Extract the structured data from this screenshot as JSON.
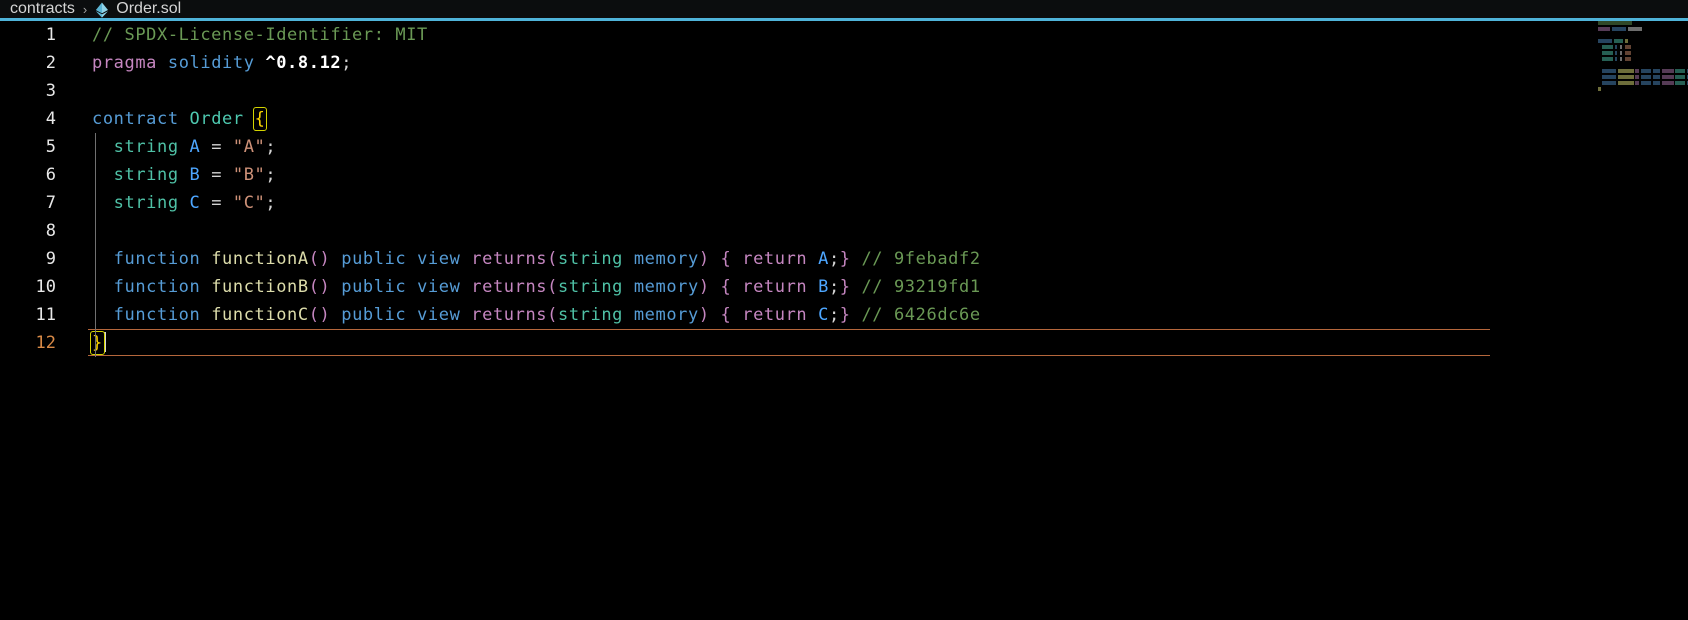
{
  "breadcrumb": {
    "folder": "contracts",
    "separator": "›",
    "file": "Order.sol",
    "file_icon": "ethereum-icon",
    "accent_color": "#4fb3d9"
  },
  "editor": {
    "language": "solidity",
    "active_line": 12,
    "cursor_line": 12,
    "cursor_column": 2,
    "background": "#000000",
    "line_count": 12,
    "lines": [
      {
        "number": "1",
        "text": "// SPDX-License-Identifier: MIT",
        "tokens": [
          {
            "t": "// SPDX-License-Identifier: MIT",
            "c": "t-comment"
          }
        ]
      },
      {
        "number": "2",
        "text": "pragma solidity ^0.8.12;",
        "tokens": [
          {
            "t": "pragma",
            "c": "t-keyword"
          },
          {
            "t": " ",
            "c": "t-plain"
          },
          {
            "t": "solidity",
            "c": "t-blue"
          },
          {
            "t": " ",
            "c": "t-plain"
          },
          {
            "t": "^0.8.12",
            "c": "t-num"
          },
          {
            "t": ";",
            "c": "t-plain"
          }
        ]
      },
      {
        "number": "3",
        "text": "",
        "tokens": []
      },
      {
        "number": "4",
        "text": "contract Order {",
        "tokens": [
          {
            "t": "contract",
            "c": "t-blue"
          },
          {
            "t": " ",
            "c": "t-plain"
          },
          {
            "t": "Order",
            "c": "t-class"
          },
          {
            "t": " ",
            "c": "t-plain"
          },
          {
            "t": "{",
            "c": "bracket-match"
          }
        ]
      },
      {
        "number": "5",
        "text": "  string A = \"A\";",
        "tokens": [
          {
            "t": "  ",
            "c": "t-plain"
          },
          {
            "t": "string",
            "c": "t-type"
          },
          {
            "t": " ",
            "c": "t-plain"
          },
          {
            "t": "A",
            "c": "t-var"
          },
          {
            "t": " = ",
            "c": "t-plain"
          },
          {
            "t": "\"A\"",
            "c": "t-string"
          },
          {
            "t": ";",
            "c": "t-plain"
          }
        ]
      },
      {
        "number": "6",
        "text": "  string B = \"B\";",
        "tokens": [
          {
            "t": "  ",
            "c": "t-plain"
          },
          {
            "t": "string",
            "c": "t-type"
          },
          {
            "t": " ",
            "c": "t-plain"
          },
          {
            "t": "B",
            "c": "t-var"
          },
          {
            "t": " = ",
            "c": "t-plain"
          },
          {
            "t": "\"B\"",
            "c": "t-string"
          },
          {
            "t": ";",
            "c": "t-plain"
          }
        ]
      },
      {
        "number": "7",
        "text": "  string C = \"C\";",
        "tokens": [
          {
            "t": "  ",
            "c": "t-plain"
          },
          {
            "t": "string",
            "c": "t-type"
          },
          {
            "t": " ",
            "c": "t-plain"
          },
          {
            "t": "C",
            "c": "t-var"
          },
          {
            "t": " = ",
            "c": "t-plain"
          },
          {
            "t": "\"C\"",
            "c": "t-string"
          },
          {
            "t": ";",
            "c": "t-plain"
          }
        ]
      },
      {
        "number": "8",
        "text": "",
        "tokens": []
      },
      {
        "number": "9",
        "text": "  function functionA() public view returns(string memory) { return A;} // 9febadf2",
        "tokens": [
          {
            "t": "  ",
            "c": "t-plain"
          },
          {
            "t": "function",
            "c": "t-blue"
          },
          {
            "t": " ",
            "c": "t-plain"
          },
          {
            "t": "functionA",
            "c": "t-func"
          },
          {
            "t": "()",
            "c": "t-punct"
          },
          {
            "t": " ",
            "c": "t-plain"
          },
          {
            "t": "public",
            "c": "t-blue"
          },
          {
            "t": " ",
            "c": "t-plain"
          },
          {
            "t": "view",
            "c": "t-blue"
          },
          {
            "t": " ",
            "c": "t-plain"
          },
          {
            "t": "returns",
            "c": "t-control"
          },
          {
            "t": "(",
            "c": "t-punct"
          },
          {
            "t": "string",
            "c": "t-type"
          },
          {
            "t": " ",
            "c": "t-plain"
          },
          {
            "t": "memory",
            "c": "t-blue"
          },
          {
            "t": ")",
            "c": "t-punct"
          },
          {
            "t": " ",
            "c": "t-plain"
          },
          {
            "t": "{",
            "c": "t-punct"
          },
          {
            "t": " ",
            "c": "t-plain"
          },
          {
            "t": "return",
            "c": "t-control"
          },
          {
            "t": " ",
            "c": "t-plain"
          },
          {
            "t": "A",
            "c": "t-var"
          },
          {
            "t": ";",
            "c": "t-plain"
          },
          {
            "t": "}",
            "c": "t-punct"
          },
          {
            "t": " ",
            "c": "t-plain"
          },
          {
            "t": "// 9febadf2",
            "c": "t-comment"
          }
        ]
      },
      {
        "number": "10",
        "text": "  function functionB() public view returns(string memory) { return B;} // 93219fd1",
        "tokens": [
          {
            "t": "  ",
            "c": "t-plain"
          },
          {
            "t": "function",
            "c": "t-blue"
          },
          {
            "t": " ",
            "c": "t-plain"
          },
          {
            "t": "functionB",
            "c": "t-func"
          },
          {
            "t": "()",
            "c": "t-punct"
          },
          {
            "t": " ",
            "c": "t-plain"
          },
          {
            "t": "public",
            "c": "t-blue"
          },
          {
            "t": " ",
            "c": "t-plain"
          },
          {
            "t": "view",
            "c": "t-blue"
          },
          {
            "t": " ",
            "c": "t-plain"
          },
          {
            "t": "returns",
            "c": "t-control"
          },
          {
            "t": "(",
            "c": "t-punct"
          },
          {
            "t": "string",
            "c": "t-type"
          },
          {
            "t": " ",
            "c": "t-plain"
          },
          {
            "t": "memory",
            "c": "t-blue"
          },
          {
            "t": ")",
            "c": "t-punct"
          },
          {
            "t": " ",
            "c": "t-plain"
          },
          {
            "t": "{",
            "c": "t-punct"
          },
          {
            "t": " ",
            "c": "t-plain"
          },
          {
            "t": "return",
            "c": "t-control"
          },
          {
            "t": " ",
            "c": "t-plain"
          },
          {
            "t": "B",
            "c": "t-var"
          },
          {
            "t": ";",
            "c": "t-plain"
          },
          {
            "t": "}",
            "c": "t-punct"
          },
          {
            "t": " ",
            "c": "t-plain"
          },
          {
            "t": "// 93219fd1",
            "c": "t-comment"
          }
        ]
      },
      {
        "number": "11",
        "text": "  function functionC() public view returns(string memory) { return C;} // 6426dc6e",
        "tokens": [
          {
            "t": "  ",
            "c": "t-plain"
          },
          {
            "t": "function",
            "c": "t-blue"
          },
          {
            "t": " ",
            "c": "t-plain"
          },
          {
            "t": "functionC",
            "c": "t-func"
          },
          {
            "t": "()",
            "c": "t-punct"
          },
          {
            "t": " ",
            "c": "t-plain"
          },
          {
            "t": "public",
            "c": "t-blue"
          },
          {
            "t": " ",
            "c": "t-plain"
          },
          {
            "t": "view",
            "c": "t-blue"
          },
          {
            "t": " ",
            "c": "t-plain"
          },
          {
            "t": "returns",
            "c": "t-control"
          },
          {
            "t": "(",
            "c": "t-punct"
          },
          {
            "t": "string",
            "c": "t-type"
          },
          {
            "t": " ",
            "c": "t-plain"
          },
          {
            "t": "memory",
            "c": "t-blue"
          },
          {
            "t": ")",
            "c": "t-punct"
          },
          {
            "t": " ",
            "c": "t-plain"
          },
          {
            "t": "{",
            "c": "t-punct"
          },
          {
            "t": " ",
            "c": "t-plain"
          },
          {
            "t": "return",
            "c": "t-control"
          },
          {
            "t": " ",
            "c": "t-plain"
          },
          {
            "t": "C",
            "c": "t-var"
          },
          {
            "t": ";",
            "c": "t-plain"
          },
          {
            "t": "}",
            "c": "t-punct"
          },
          {
            "t": " ",
            "c": "t-plain"
          },
          {
            "t": "// 6426dc6e",
            "c": "t-comment"
          }
        ]
      },
      {
        "number": "12",
        "text": "}",
        "active": true,
        "tokens": [
          {
            "t": "}",
            "c": "bracket-match"
          }
        ]
      }
    ]
  },
  "minimap": {
    "visible": true,
    "rows": [
      {
        "blocks": [
          {
            "w": 34,
            "x": 6,
            "color": "#3c5a32"
          }
        ]
      },
      {
        "blocks": [
          {
            "w": 12,
            "x": 6,
            "color": "#6b4a6b"
          },
          {
            "w": 14,
            "x": 2,
            "color": "#2f5577"
          },
          {
            "w": 14,
            "x": 2,
            "color": "#888888"
          }
        ]
      },
      {
        "blocks": []
      },
      {
        "blocks": [
          {
            "w": 14,
            "x": 6,
            "color": "#2f5577"
          },
          {
            "w": 9,
            "x": 2,
            "color": "#2f7768"
          },
          {
            "w": 3,
            "x": 2,
            "color": "#8a8a4a"
          }
        ]
      },
      {
        "blocks": [
          {
            "w": 11,
            "x": 10,
            "color": "#2f7768"
          },
          {
            "w": 2,
            "x": 2,
            "color": "#2f5577"
          },
          {
            "w": 2,
            "x": 3,
            "color": "#888888"
          },
          {
            "w": 6,
            "x": 3,
            "color": "#7a5440"
          }
        ]
      },
      {
        "blocks": [
          {
            "w": 11,
            "x": 10,
            "color": "#2f7768"
          },
          {
            "w": 2,
            "x": 2,
            "color": "#2f5577"
          },
          {
            "w": 2,
            "x": 3,
            "color": "#888888"
          },
          {
            "w": 6,
            "x": 3,
            "color": "#7a5440"
          }
        ]
      },
      {
        "blocks": [
          {
            "w": 11,
            "x": 10,
            "color": "#2f7768"
          },
          {
            "w": 2,
            "x": 2,
            "color": "#2f5577"
          },
          {
            "w": 2,
            "x": 3,
            "color": "#888888"
          },
          {
            "w": 6,
            "x": 3,
            "color": "#7a5440"
          }
        ]
      },
      {
        "blocks": []
      },
      {
        "blocks": [
          {
            "w": 14,
            "x": 10,
            "color": "#2f5577"
          },
          {
            "w": 16,
            "x": 2,
            "color": "#8a8a4a"
          },
          {
            "w": 4,
            "x": 1,
            "color": "#6b4a6b"
          },
          {
            "w": 10,
            "x": 2,
            "color": "#2f5577"
          },
          {
            "w": 7,
            "x": 2,
            "color": "#2f5577"
          },
          {
            "w": 12,
            "x": 2,
            "color": "#6b4a6b"
          },
          {
            "w": 10,
            "x": 1,
            "color": "#2f7768"
          },
          {
            "w": 11,
            "x": 2,
            "color": "#2f5577"
          },
          {
            "w": 11,
            "x": 4,
            "color": "#6b4a6b"
          },
          {
            "w": 16,
            "x": 4,
            "color": "#3c5a32"
          }
        ]
      },
      {
        "blocks": [
          {
            "w": 14,
            "x": 10,
            "color": "#2f5577"
          },
          {
            "w": 16,
            "x": 2,
            "color": "#8a8a4a"
          },
          {
            "w": 4,
            "x": 1,
            "color": "#6b4a6b"
          },
          {
            "w": 10,
            "x": 2,
            "color": "#2f5577"
          },
          {
            "w": 7,
            "x": 2,
            "color": "#2f5577"
          },
          {
            "w": 12,
            "x": 2,
            "color": "#6b4a6b"
          },
          {
            "w": 10,
            "x": 1,
            "color": "#2f7768"
          },
          {
            "w": 11,
            "x": 2,
            "color": "#2f5577"
          },
          {
            "w": 11,
            "x": 4,
            "color": "#6b4a6b"
          },
          {
            "w": 16,
            "x": 4,
            "color": "#3c5a32"
          }
        ]
      },
      {
        "blocks": [
          {
            "w": 14,
            "x": 10,
            "color": "#2f5577"
          },
          {
            "w": 16,
            "x": 2,
            "color": "#8a8a4a"
          },
          {
            "w": 4,
            "x": 1,
            "color": "#6b4a6b"
          },
          {
            "w": 10,
            "x": 2,
            "color": "#2f5577"
          },
          {
            "w": 7,
            "x": 2,
            "color": "#2f5577"
          },
          {
            "w": 12,
            "x": 2,
            "color": "#6b4a6b"
          },
          {
            "w": 10,
            "x": 1,
            "color": "#2f7768"
          },
          {
            "w": 11,
            "x": 2,
            "color": "#2f5577"
          },
          {
            "w": 11,
            "x": 4,
            "color": "#6b4a6b"
          },
          {
            "w": 16,
            "x": 4,
            "color": "#3c5a32"
          }
        ]
      },
      {
        "blocks": [
          {
            "w": 3,
            "x": 6,
            "color": "#8a8a4a"
          }
        ]
      }
    ]
  }
}
